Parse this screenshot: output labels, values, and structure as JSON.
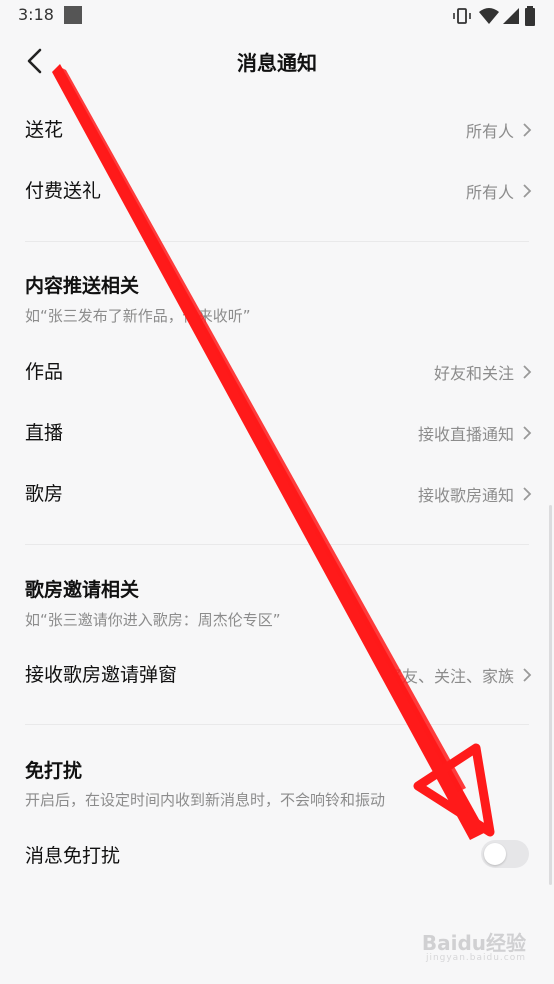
{
  "status_bar": {
    "time": "3:18"
  },
  "header": {
    "title": "消息通知"
  },
  "gift_rows": [
    {
      "label": "送花",
      "value": "所有人"
    },
    {
      "label": "付费送礼",
      "value": "所有人"
    }
  ],
  "content_push": {
    "title": "内容推送相关",
    "desc": "如“张三发布了新作品，你来收听”",
    "rows": [
      {
        "label": "作品",
        "value": "好友和关注"
      },
      {
        "label": "直播",
        "value": "接收直播通知"
      },
      {
        "label": "歌房",
        "value": "接收歌房通知"
      }
    ]
  },
  "room_invite": {
    "title": "歌房邀请相关",
    "desc": "如“张三邀请你进入歌房：周杰伦专区”",
    "row": {
      "label": "接收歌房邀请弹窗",
      "value": "好友、关注、家族"
    }
  },
  "dnd": {
    "title": "免打扰",
    "desc": "开启后，在设定时间内收到新消息时，不会响铃和振动",
    "row": {
      "label": "消息免打扰",
      "enabled": false
    }
  },
  "watermark": {
    "text": "Baidu经验",
    "sub": "jingyan.baidu.com"
  },
  "colors": {
    "arrow": "#ff1a1a",
    "toggle_off": "#e6e6e8",
    "secondary_text": "#8c8c8c"
  }
}
